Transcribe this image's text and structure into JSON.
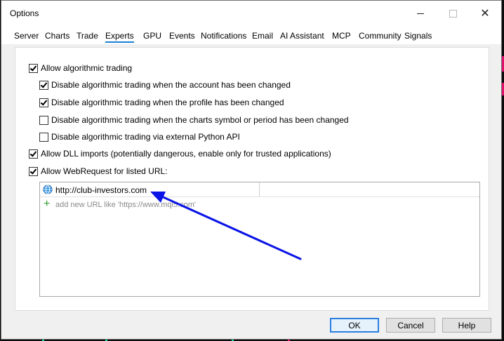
{
  "window": {
    "title": "Options"
  },
  "tabs": [
    {
      "label": "Server"
    },
    {
      "label": "Charts"
    },
    {
      "label": "Trade"
    },
    {
      "label": "Experts"
    },
    {
      "label": "GPU"
    },
    {
      "label": "Events"
    },
    {
      "label": "Notifications"
    },
    {
      "label": "Email"
    },
    {
      "label": "AI Assistant"
    },
    {
      "label": "MCP"
    },
    {
      "label": "Community"
    },
    {
      "label": "Signals"
    }
  ],
  "active_tab": "Experts",
  "options": [
    {
      "label": "Allow algorithmic trading",
      "checked": true
    },
    {
      "label": "Disable algorithmic trading when the account has been changed",
      "checked": true
    },
    {
      "label": "Disable algorithmic trading when the profile has been changed",
      "checked": true
    },
    {
      "label": "Disable algorithmic trading when the charts symbol or period has been changed",
      "checked": false
    },
    {
      "label": "Disable algorithmic trading via external Python API",
      "checked": false
    },
    {
      "label": "Allow DLL imports (potentially dangerous, enable only for trusted applications)",
      "checked": true
    },
    {
      "label": "Allow WebRequest for listed URL:",
      "checked": true
    }
  ],
  "url_list": {
    "items": [
      {
        "url": "http://club-investors.com",
        "icon": "globe-icon"
      }
    ],
    "add_placeholder": "add new URL like 'https://www.mql5.com'"
  },
  "buttons": {
    "ok": "OK",
    "cancel": "Cancel",
    "help": "Help"
  },
  "colors": {
    "accent": "#1a7fd4",
    "arrow": "#0a14e6",
    "plus": "#33a133"
  }
}
